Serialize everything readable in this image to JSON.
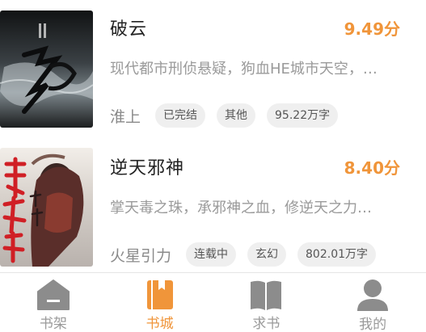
{
  "books": [
    {
      "title": "破云",
      "score": "9.49分",
      "description": "现代都市刑侦悬疑，狗血HE城市天空，…",
      "author": "淮上",
      "tags": [
        "已完结",
        "其他",
        "95.22万字"
      ],
      "cover_theme": "dark-grey"
    },
    {
      "title": "逆天邪神",
      "score": "8.40分",
      "description": "掌天毒之珠，承邪神之血，修逆天之力…",
      "author": "火星引力",
      "tags": [
        "连载中",
        "玄幻",
        "802.01万字"
      ],
      "cover_theme": "red-warrior"
    }
  ],
  "tabbar": {
    "items": [
      {
        "label": "书架",
        "icon": "bookshelf-icon",
        "active": false
      },
      {
        "label": "书城",
        "icon": "bookstore-icon",
        "active": true
      },
      {
        "label": "求书",
        "icon": "open-book-icon",
        "active": false
      },
      {
        "label": "我的",
        "icon": "user-icon",
        "active": false
      }
    ]
  },
  "colors": {
    "accent": "#f0953a",
    "inactive_icon": "#8c8c8c",
    "tag_bg": "#efefef",
    "description": "#9a9a9a"
  }
}
